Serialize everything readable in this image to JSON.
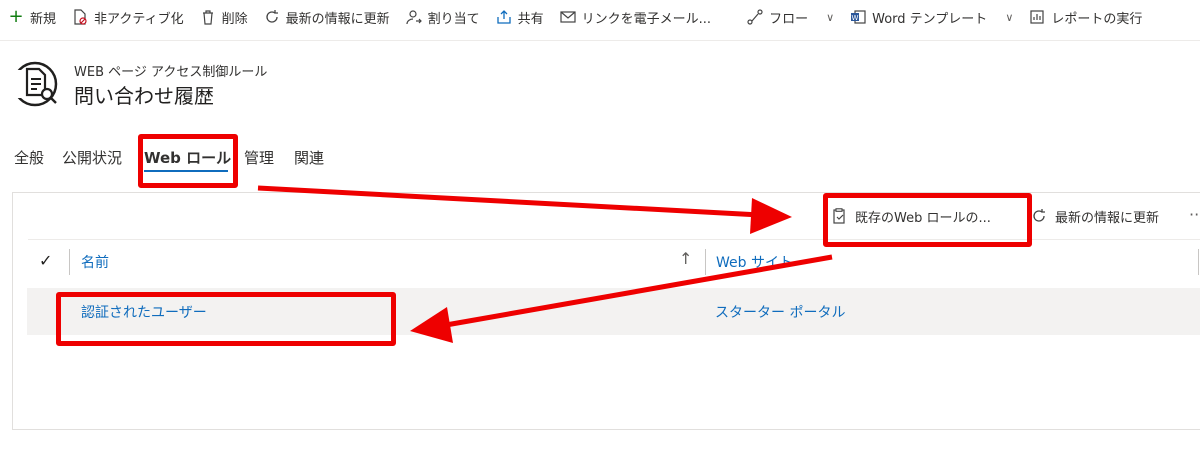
{
  "toolbar": {
    "items": [
      {
        "label": "新規",
        "icon": "plus-icon"
      },
      {
        "label": "非アクティブ化",
        "icon": "deactivate-document-icon"
      },
      {
        "label": "削除",
        "icon": "trash-icon"
      },
      {
        "label": "最新の情報に更新",
        "icon": "refresh-icon"
      },
      {
        "label": "割り当て",
        "icon": "assign-person-icon"
      },
      {
        "label": "共有",
        "icon": "share-icon"
      },
      {
        "label": "リンクを電子メール...",
        "icon": "email-link-icon"
      },
      {
        "label": "フロー",
        "icon": "flow-icon"
      },
      {
        "label": "Word テンプレート",
        "icon": "word-icon"
      },
      {
        "label": "レポートの実行",
        "icon": "report-icon"
      }
    ]
  },
  "header": {
    "entity_type": "WEB ページ アクセス制御ルール",
    "title": "問い合わせ履歴"
  },
  "tabs": [
    {
      "label": "全般"
    },
    {
      "label": "公開状況"
    },
    {
      "label": "Web ロール",
      "selected": true
    },
    {
      "label": "管理"
    },
    {
      "label": "関連"
    }
  ],
  "subgrid": {
    "commands": {
      "add_existing": "既存のWeb ロールの...",
      "refresh": "最新の情報に更新",
      "more": "···"
    },
    "columns": {
      "name": "名前",
      "website": "Web サイト"
    },
    "rows": [
      {
        "name": "認証されたユーザー",
        "website": "スターター ポータル"
      }
    ]
  },
  "colors": {
    "accent": "#0f6cbd",
    "annotation": "#ee0000",
    "row_bg": "#f3f2f1"
  }
}
